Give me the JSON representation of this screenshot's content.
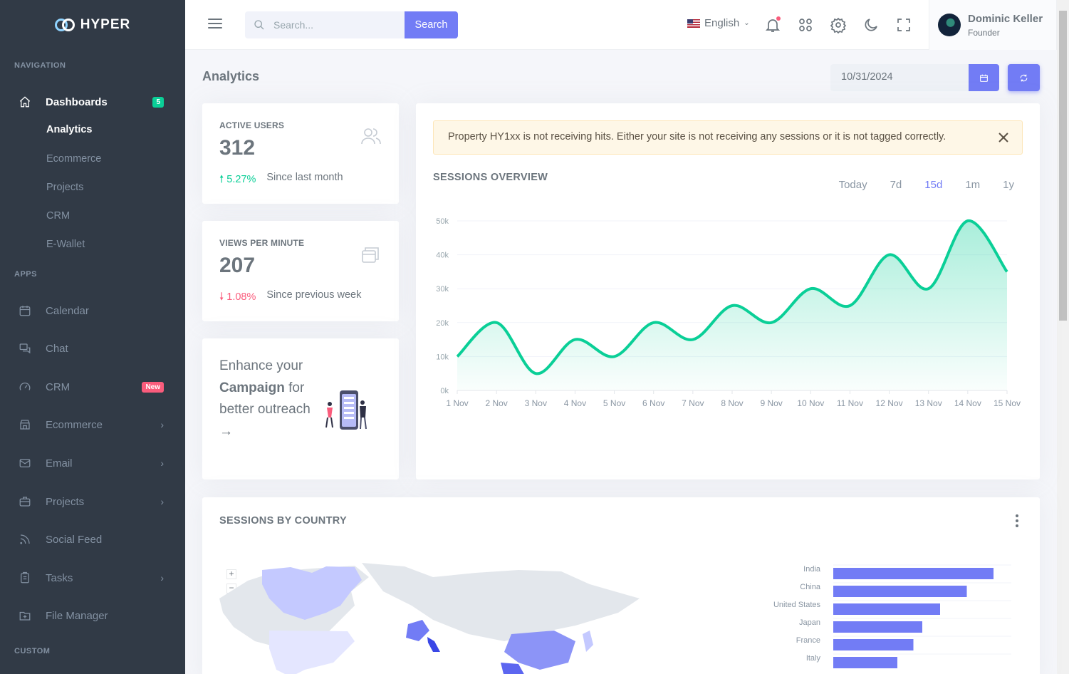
{
  "brand": {
    "name": "HYPER"
  },
  "sidebar": {
    "sections": [
      "Navigation",
      "Apps",
      "Custom"
    ],
    "dashboards": {
      "label": "Dashboards",
      "badge": "5"
    },
    "dashboard_sub": [
      "Analytics",
      "Ecommerce",
      "Projects",
      "CRM",
      "E-Wallet"
    ],
    "apps": [
      {
        "label": "Calendar",
        "icon": "calendar-icon"
      },
      {
        "label": "Chat",
        "icon": "chat-icon"
      },
      {
        "label": "CRM",
        "icon": "gauge-icon",
        "badge": "New"
      },
      {
        "label": "Ecommerce",
        "icon": "store-icon",
        "chevron": true
      },
      {
        "label": "Email",
        "icon": "mail-icon",
        "chevron": true
      },
      {
        "label": "Projects",
        "icon": "briefcase-icon",
        "chevron": true
      },
      {
        "label": "Social Feed",
        "icon": "rss-icon"
      },
      {
        "label": "Tasks",
        "icon": "clipboard-icon",
        "chevron": true
      },
      {
        "label": "File Manager",
        "icon": "folder-icon"
      }
    ]
  },
  "topbar": {
    "search_placeholder": "Search...",
    "search_button": "Search",
    "language": "English",
    "user": {
      "name": "Dominic Keller",
      "role": "Founder"
    }
  },
  "page": {
    "title": "Analytics",
    "date": "10/31/2024"
  },
  "stats": [
    {
      "label": "Active Users",
      "value": "312",
      "change": "5.27%",
      "direction": "up",
      "since": "Since last month"
    },
    {
      "label": "Views Per Minute",
      "value": "207",
      "change": "1.08%",
      "direction": "down",
      "since": "Since previous week"
    }
  ],
  "promo": {
    "line1": "Enhance your",
    "bold": "Campaign",
    "line2": "for better outreach"
  },
  "alert": {
    "text": "Property HY1xx is not receiving hits. Either your site is not receiving any sessions or it is not tagged correctly."
  },
  "sessions_overview": {
    "title": "Sessions Overview",
    "ranges": [
      "Today",
      "7d",
      "15d",
      "1m",
      "1y"
    ],
    "active_range": "15d"
  },
  "sessions_by_country": {
    "title": "Sessions By Country"
  },
  "colors": {
    "primary": "#727cf5",
    "success": "#0acf97",
    "danger": "#fa5c7c",
    "sidebar": "#313a46"
  },
  "chart_data": [
    {
      "type": "area",
      "title": "",
      "x": [
        "1 Nov",
        "2 Nov",
        "3 Nov",
        "4 Nov",
        "5 Nov",
        "6 Nov",
        "7 Nov",
        "8 Nov",
        "9 Nov",
        "10 Nov",
        "11 Nov",
        "12 Nov",
        "13 Nov",
        "14 Nov",
        "15 Nov"
      ],
      "values": [
        10,
        20,
        5,
        15,
        10,
        20,
        15,
        25,
        20,
        30,
        25,
        40,
        30,
        50,
        35
      ],
      "yticks": [
        "0k",
        "10k",
        "20k",
        "30k",
        "40k",
        "50k"
      ],
      "ylim": [
        0,
        50
      ],
      "color": "#0acf97"
    },
    {
      "type": "bar",
      "orientation": "horizontal",
      "categories": [
        "India",
        "China",
        "United States",
        "Japan",
        "France",
        "Italy"
      ],
      "values": [
        90,
        75,
        60,
        50,
        45,
        36
      ],
      "color": "#727cf5"
    }
  ]
}
